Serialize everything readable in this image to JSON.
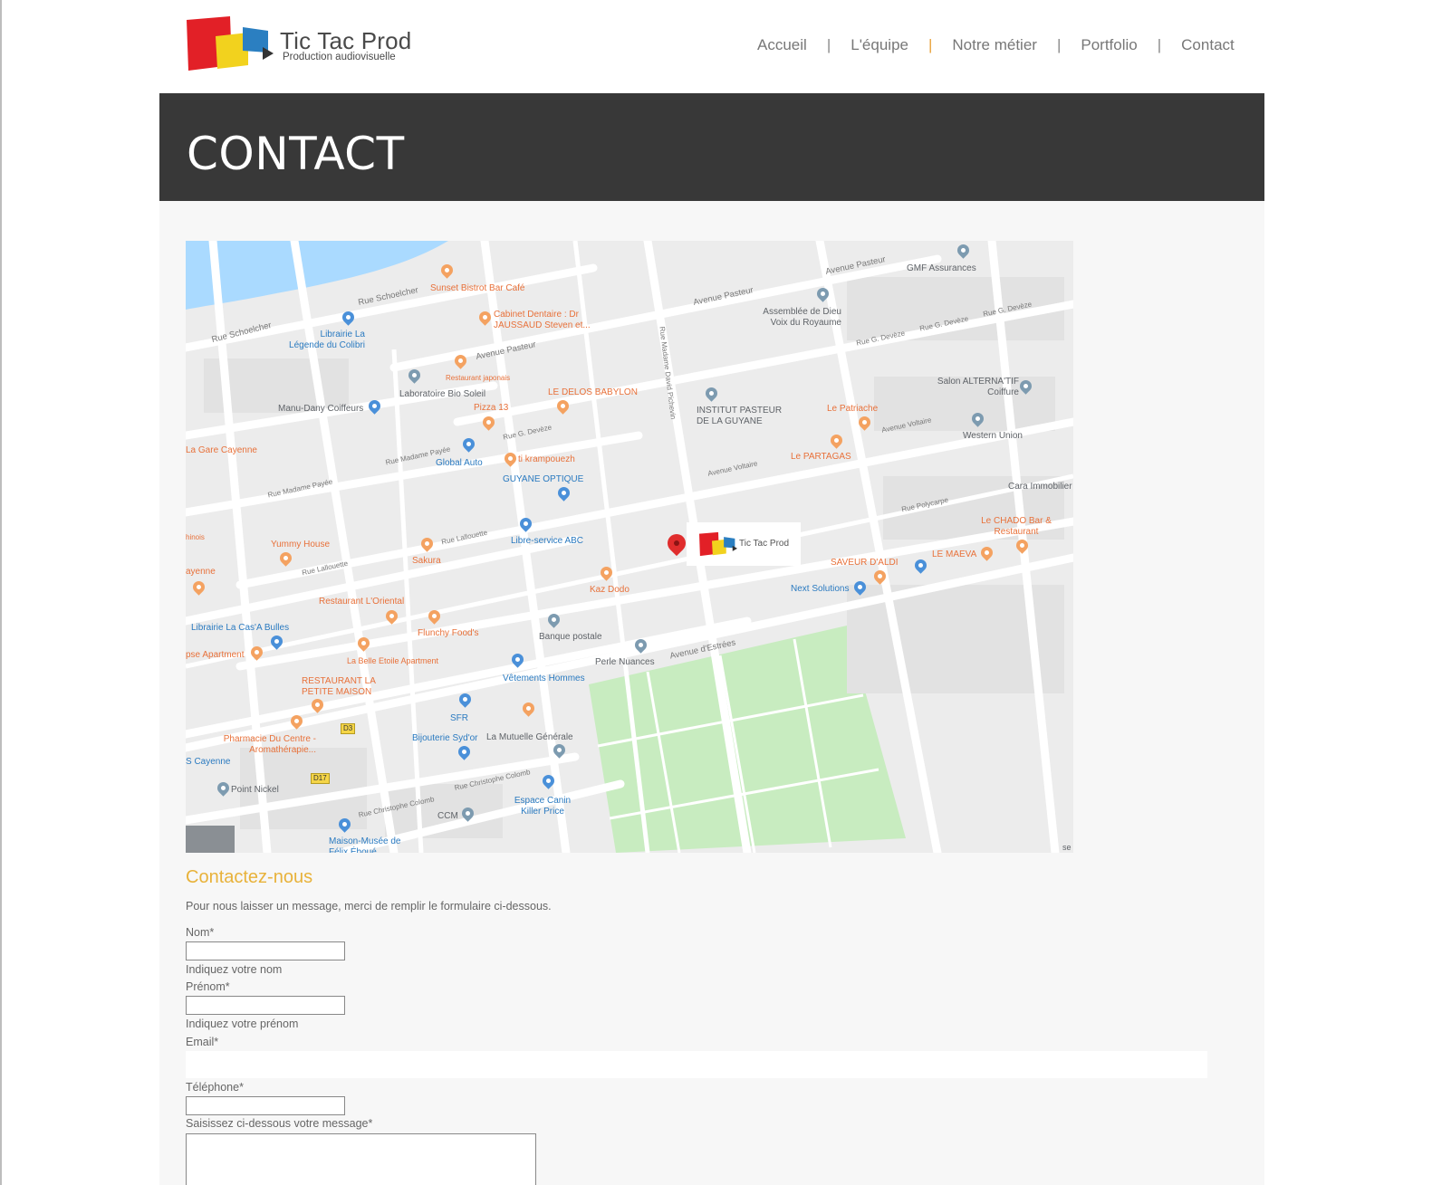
{
  "site": {
    "logo_title": "Tic Tac Prod",
    "logo_subtitle": "Production audiovisuelle"
  },
  "nav": {
    "items": [
      "Accueil",
      "L'équipe",
      "Notre métier",
      "Portfolio",
      "Contact"
    ],
    "separator": "|"
  },
  "page": {
    "title": "CONTACT"
  },
  "map": {
    "logo_text": "Tic Tac Prod",
    "road_badges": [
      "D3",
      "D17"
    ],
    "streets": [
      "Rue Schoelcher",
      "Avenue Pasteur",
      "Avenue Pasteur",
      "Rue G. Devèze",
      "Rue G. Devèze",
      "Rue Madame Payée",
      "Rue Madame Payée",
      "Rue Lallouette",
      "Rue Lallouette",
      "Avenue Voltaire",
      "Avenue Voltaire",
      "Rue Polycarpe",
      "Avenue d'Estrées",
      "Rue Christophe Colomb",
      "Rue Christophe Colomb",
      "Rue Madame David Pichevin",
      "Rue G. Devèze",
      "Rue G. Devèze"
    ],
    "places": [
      "Sunset Bistrot Bar Café",
      "Cabinet Dentaire : Dr JAUSSAUD Steven et...",
      "Librairie La Légende du Colibri",
      "Laboratoire Bio Soleil",
      "Restaurant japonais",
      "LE DELOS BABYLON",
      "Pizza 13",
      "Manu-Dany Coiffeurs",
      "INSTITUT PASTEUR DE LA GUYANE",
      "Le Patriache",
      "GMF Assurances",
      "Assemblée de Dieu Voix du Royaume",
      "Salon ALTERNA'TIF Coiffure",
      "Western Union",
      "La Gare Cayenne",
      "Global Auto",
      "ti krampouezh",
      "GUYANE OPTIQUE",
      "Le PARTAGAS",
      "Cara Immobilier",
      "Yummy House",
      "Sakura",
      "Libre-service ABC",
      "Le CHADO Bar & Restaurant",
      "LE MAEVA",
      "SAVEUR D'ALDI",
      "Next Solutions",
      "Kaz Dodo",
      "Restaurant L'Oriental",
      "Librairie La Cas'A Bulles",
      "Flunchy Food's",
      "Banque postale",
      "Perle Nuances",
      "La Belle Etoile Apartment",
      "RESTAURANT LA PETITE MAISON",
      "Vêtements Hommes",
      "SFR",
      "Pharmacie Du Centre - Aromathérapie...",
      "Bijouterie Syd'or",
      "La Mutuelle Générale",
      "S Cayenne",
      "Point Nickel",
      "CCM",
      "Espace Canin Killer Price",
      "Maison-Musée de Félix Éboué",
      "hinois",
      "ayenne",
      "pse Apartment",
      "se"
    ]
  },
  "form": {
    "heading": "Contactez-nous",
    "intro": "Pour nous laisser un message, merci de remplir le formulaire ci-dessous.",
    "nom_label": "Nom*",
    "nom_help": "Indiquez votre nom",
    "prenom_label": "Prénom*",
    "prenom_help": "Indiquez votre prénom",
    "email_label": "Email*",
    "telephone_label": "Téléphone*",
    "message_label": "Saisissez ci-dessous votre message*"
  },
  "colors": {
    "banner": "#383838",
    "accent": "#e8b23a",
    "logo_red": "#e22027",
    "logo_yellow": "#f2d21e",
    "logo_blue": "#2b7fc1"
  }
}
